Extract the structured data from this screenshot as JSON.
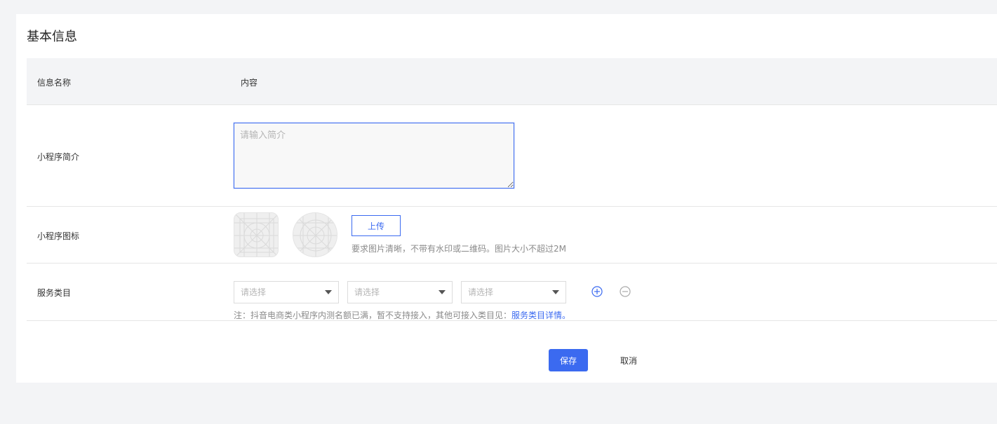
{
  "section": {
    "title": "基本信息"
  },
  "table": {
    "header": {
      "name_col": "信息名称",
      "content_col": "内容"
    }
  },
  "intro": {
    "label": "小程序简介",
    "value": "",
    "placeholder": "请输入简介"
  },
  "icon": {
    "label": "小程序图标",
    "upload_label": "上传",
    "hint": "要求图片清晰，不带有水印或二维码。图片大小不超过2M"
  },
  "service": {
    "label": "服务类目",
    "selects": [
      {
        "selected": "请选择"
      },
      {
        "selected": "请选择"
      },
      {
        "selected": "请选择"
      }
    ],
    "note_prefix": "注：抖音电商类小程序内测名额已满，暂不支持接入，其他可接入类目见：",
    "note_link": "服务类目详情。"
  },
  "actions": {
    "save_label": "保存",
    "cancel_label": "取消"
  },
  "icons": {
    "square_placeholder": "app-icon-placeholder-square-icon",
    "circle_placeholder": "app-icon-placeholder-circle-icon",
    "add": "plus-circle-icon",
    "remove": "minus-circle-icon",
    "dropdown": "caret-down-icon"
  },
  "colors": {
    "accent": "#3b6af0",
    "header_bg": "#f3f4f6",
    "page_bg": "#f3f4f6"
  }
}
